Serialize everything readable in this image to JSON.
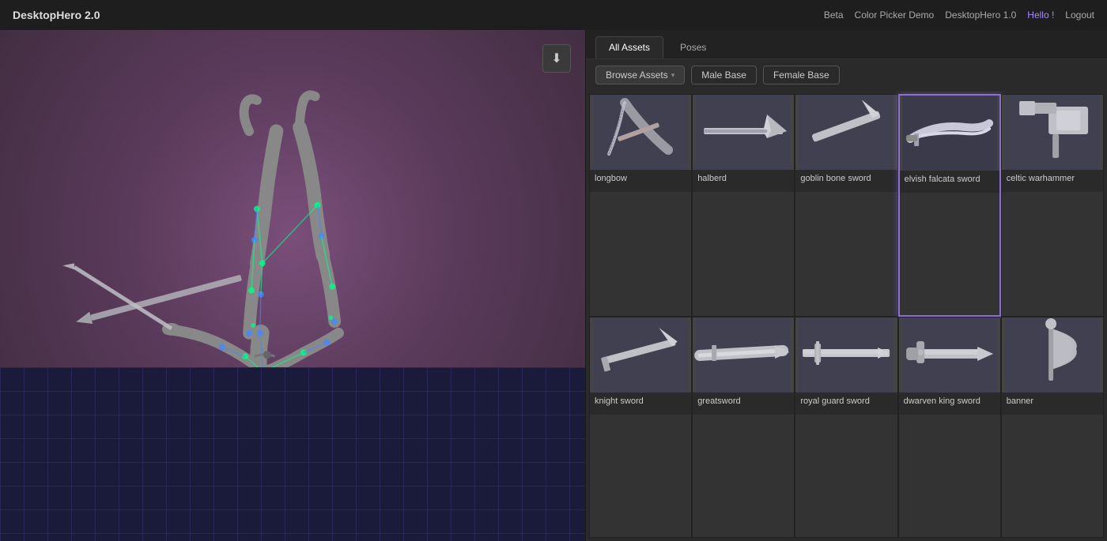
{
  "app": {
    "title": "DesktopHero 2.0"
  },
  "nav": {
    "beta": "Beta",
    "color_picker": "Color Picker Demo",
    "deskto_hero_1": "DesktopHero 1.0",
    "hello": "Hello !",
    "logout": "Logout"
  },
  "tabs": [
    {
      "id": "all-assets",
      "label": "All Assets",
      "active": true
    },
    {
      "id": "poses",
      "label": "Poses",
      "active": false
    }
  ],
  "filters": {
    "browse_assets": "Browse Assets",
    "male_base": "Male Base",
    "female_base": "Female Base"
  },
  "assets": [
    {
      "id": "longbow",
      "label": "longbow",
      "selected": false,
      "color": "#5a5a6a",
      "shape": "longbow"
    },
    {
      "id": "halberd",
      "label": "halberd",
      "selected": false,
      "color": "#5a5a6a",
      "shape": "halberd"
    },
    {
      "id": "goblin-bone-sword",
      "label": "goblin bone sword",
      "selected": false,
      "color": "#5a5a6a",
      "shape": "sword-diagonal"
    },
    {
      "id": "elvish-falcata-sword",
      "label": "elvish falcata sword",
      "selected": true,
      "color": "#5a5a6a",
      "shape": "falcata"
    },
    {
      "id": "celtic-warhammer",
      "label": "celtic warhammer",
      "selected": false,
      "color": "#5a5a6a",
      "shape": "warhammer"
    },
    {
      "id": "knight-sword",
      "label": "knight sword",
      "selected": false,
      "color": "#5a5a6a",
      "shape": "knight-sword"
    },
    {
      "id": "greatsword",
      "label": "greatsword",
      "selected": false,
      "color": "#5a5a6a",
      "shape": "greatsword"
    },
    {
      "id": "royal-guard-sword",
      "label": "royal guard sword",
      "selected": false,
      "color": "#5a5a6a",
      "shape": "royal-guard"
    },
    {
      "id": "dwarven-king-sword",
      "label": "dwarven king sword",
      "selected": false,
      "color": "#5a5a6a",
      "shape": "dwarven"
    },
    {
      "id": "banner",
      "label": "banner",
      "selected": false,
      "color": "#5a5a6a",
      "shape": "banner"
    }
  ],
  "icons": {
    "download": "⬇",
    "dropdown_arrow": "▾"
  }
}
